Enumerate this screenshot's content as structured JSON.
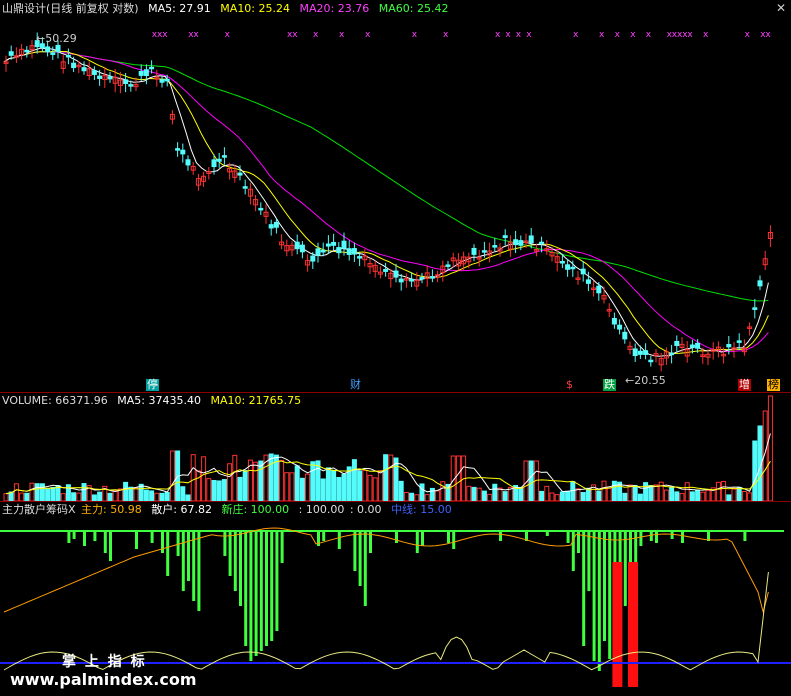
{
  "price_header": {
    "title": "山鼎设计(日线 前复权 对数)",
    "ma5": "MA5: 27.91",
    "ma10": "MA10: 25.24",
    "ma20": "MA20: 23.76",
    "ma60": "MA60: 25.42"
  },
  "price_labels": {
    "high": "50.29",
    "low": "20.55"
  },
  "event_tags": [
    {
      "text": "停"
    },
    {
      "text": "财"
    },
    {
      "text": "$"
    },
    {
      "text": "跌"
    },
    {
      "text": "增"
    },
    {
      "text": "榜"
    }
  ],
  "volume_header": {
    "title": "VOLUME: 66371.96",
    "ma5": "MA5: 37435.40",
    "ma10": "MA10: 21765.75"
  },
  "indicator_header": {
    "title": "主力散户筹码X",
    "main": "主力: 50.98",
    "retail": "散户: 67.82",
    "new": "新庄: 100.00",
    "v1": ": 100.00",
    "v2": ": 0.00",
    "mid": "中线: 15.00"
  },
  "watermark": {
    "cn": "掌 上 指 标",
    "url": "www.palmindex.com"
  },
  "colors": {
    "up": "#ff3232",
    "down": "#54fcfc",
    "ma5": "#ffffff",
    "ma10": "#ffff00",
    "ma20": "#ff00ff",
    "ma60": "#00e000",
    "green_bar": "#40ff40",
    "red_bar": "#ff1010",
    "blue_line": "#2020ff"
  }
}
